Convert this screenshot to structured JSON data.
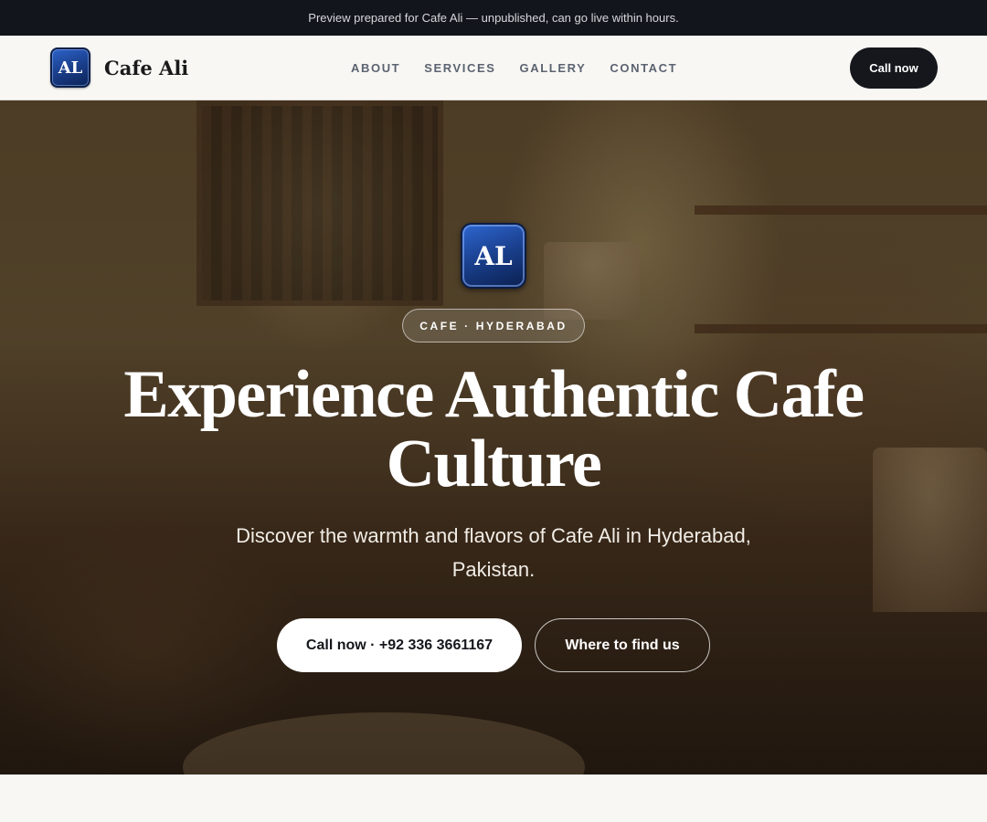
{
  "announcement": {
    "text": "Preview prepared for Cafe Ali — unpublished, can go live within hours."
  },
  "header": {
    "logo_text": "AL",
    "brand_name": "Cafe Ali",
    "nav": [
      {
        "label": "ABOUT"
      },
      {
        "label": "SERVICES"
      },
      {
        "label": "GALLERY"
      },
      {
        "label": "CONTACT"
      }
    ],
    "cta_label": "Call now"
  },
  "hero": {
    "logo_text": "AL",
    "badge": "CAFE · HYDERABAD",
    "headline": "Experience Authentic Cafe Culture",
    "subheading": "Discover the warmth and flavors of Cafe Ali in Hyderabad, Pakistan.",
    "primary_button": "Call now · +92 336 3661167",
    "secondary_button": "Where to find us",
    "background_image": "cafe-interior-photo"
  },
  "colors": {
    "topbar_bg": "#12151b",
    "page_bg": "#f8f7f4",
    "cta_bg": "#15171c",
    "logo_blue": "#1a3f8c"
  }
}
